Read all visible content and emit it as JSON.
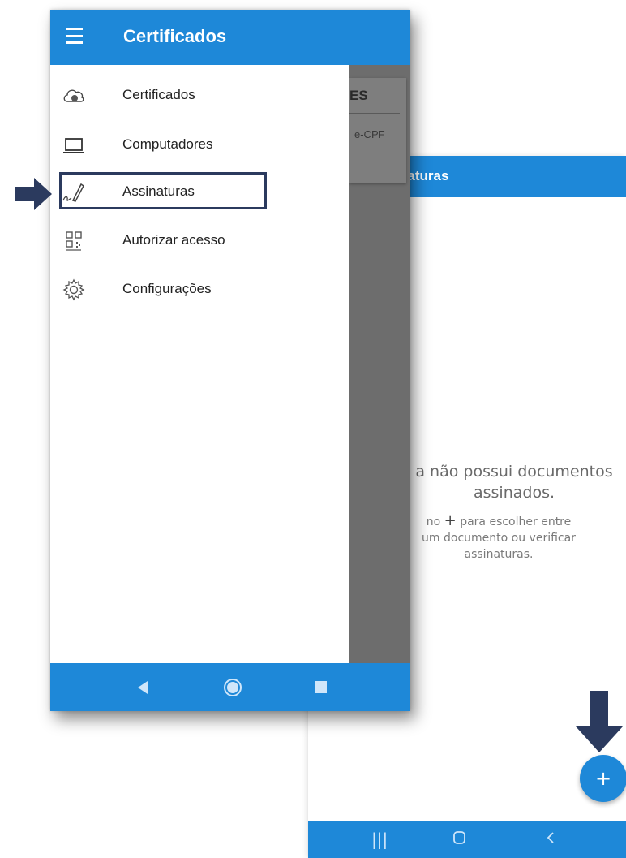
{
  "drawer": {
    "title": "Certificados",
    "items": [
      {
        "label": "Certificados",
        "icon": "cloud-certificate-icon"
      },
      {
        "label": "Computadores",
        "icon": "laptop-icon"
      },
      {
        "label": "Assinaturas",
        "icon": "signature-pen-icon"
      },
      {
        "label": "Autorizar acesso",
        "icon": "qr-code-icon"
      },
      {
        "label": "Configurações",
        "icon": "gear-icon"
      }
    ]
  },
  "background_card": {
    "heading_fragment": "ES",
    "subtitle_fragment": "e-CPF"
  },
  "signatures_screen": {
    "title_fragment": "naturas",
    "empty_line1": "a não possui documentos",
    "empty_line2": "assinados.",
    "hint_line1_prefix": "no",
    "hint_plus": "+",
    "hint_line1_suffix": "para escolher entre",
    "hint_line2": "um documento ou verificar",
    "hint_line3": "assinaturas.",
    "fab_label": "+"
  },
  "colors": {
    "primary": "#1e88d8",
    "annotation": "#2b3a5e",
    "scrim": "#6d6d6d"
  }
}
